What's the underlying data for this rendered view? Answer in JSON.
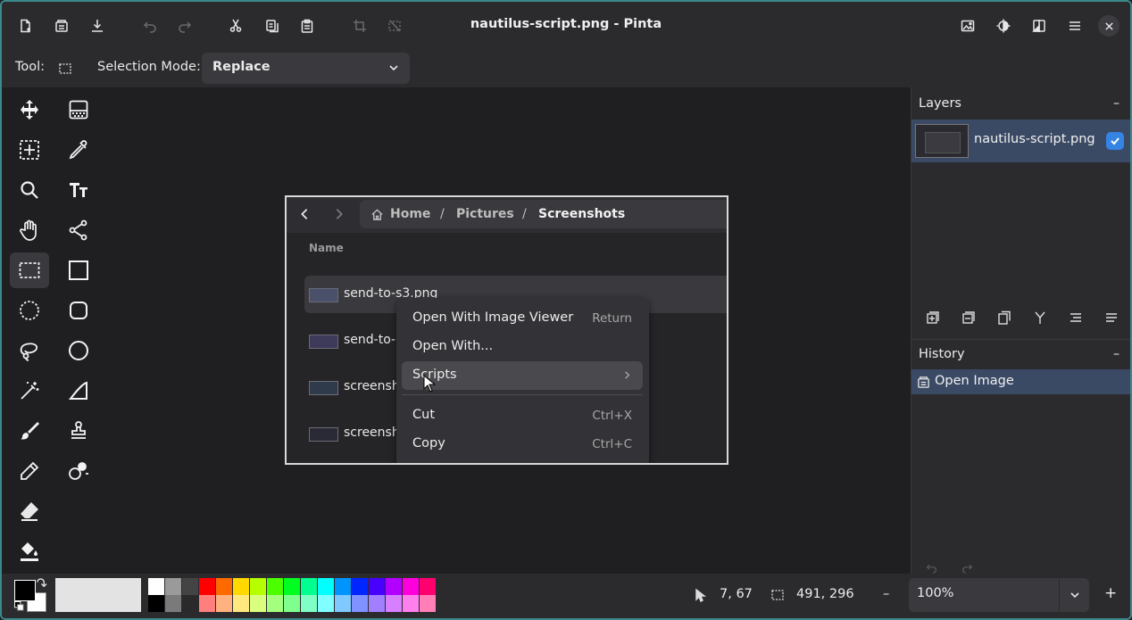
{
  "window": {
    "title": "nautilus-script.png - Pinta"
  },
  "toolbar": {
    "tool_label": "Tool:",
    "selection_mode_label": "Selection Mode:",
    "selection_mode_value": "Replace"
  },
  "image": {
    "breadcrumb": [
      "Home",
      "Pictures",
      "Screenshots"
    ],
    "column_header": "Name",
    "files": [
      "send-to-s3.png",
      "send-to-",
      "screensho",
      "screensho"
    ],
    "context_menu": [
      {
        "label": "Open With Image Viewer",
        "accel": "Return"
      },
      {
        "label": "Open With...",
        "accel": ""
      },
      {
        "label": "Scripts",
        "accel": ""
      },
      {
        "label": "Cut",
        "accel": "Ctrl+X"
      },
      {
        "label": "Copy",
        "accel": "Ctrl+C"
      }
    ]
  },
  "layers": {
    "title": "Layers",
    "minimize": "–",
    "items": [
      {
        "name": "nautilus-script.png",
        "visible": true
      }
    ]
  },
  "history": {
    "title": "History",
    "minimize": "–",
    "items": [
      "Open Image"
    ]
  },
  "statusbar": {
    "cursor_position": "7, 67",
    "selection_size": "491, 296",
    "zoom": "100%",
    "zoom_out": "–",
    "zoom_in": "+"
  },
  "palette": {
    "primary": "#000000",
    "secondary": "#ffffff",
    "top_row": [
      "#ffffff",
      "#9a9a9a",
      "#444444",
      "#ff0000",
      "#ff6a00",
      "#ffd800",
      "#b6ff00",
      "#4cff00",
      "#00ff21",
      "#00ff90",
      "#00ffff",
      "#0094ff",
      "#0026ff",
      "#4800ff",
      "#b200ff",
      "#ff00dc",
      "#ff006e"
    ],
    "bottom_row": [
      "#000000",
      "#7a7a7a",
      "#2a2a2a",
      "#ff7f7f",
      "#ffb27f",
      "#ffe97f",
      "#daff7f",
      "#a5ff7f",
      "#7fff8e",
      "#7fffc5",
      "#7fffff",
      "#7fc9ff",
      "#7f92ff",
      "#a17fff",
      "#d67fff",
      "#ff7fed",
      "#ff7fb6"
    ]
  }
}
